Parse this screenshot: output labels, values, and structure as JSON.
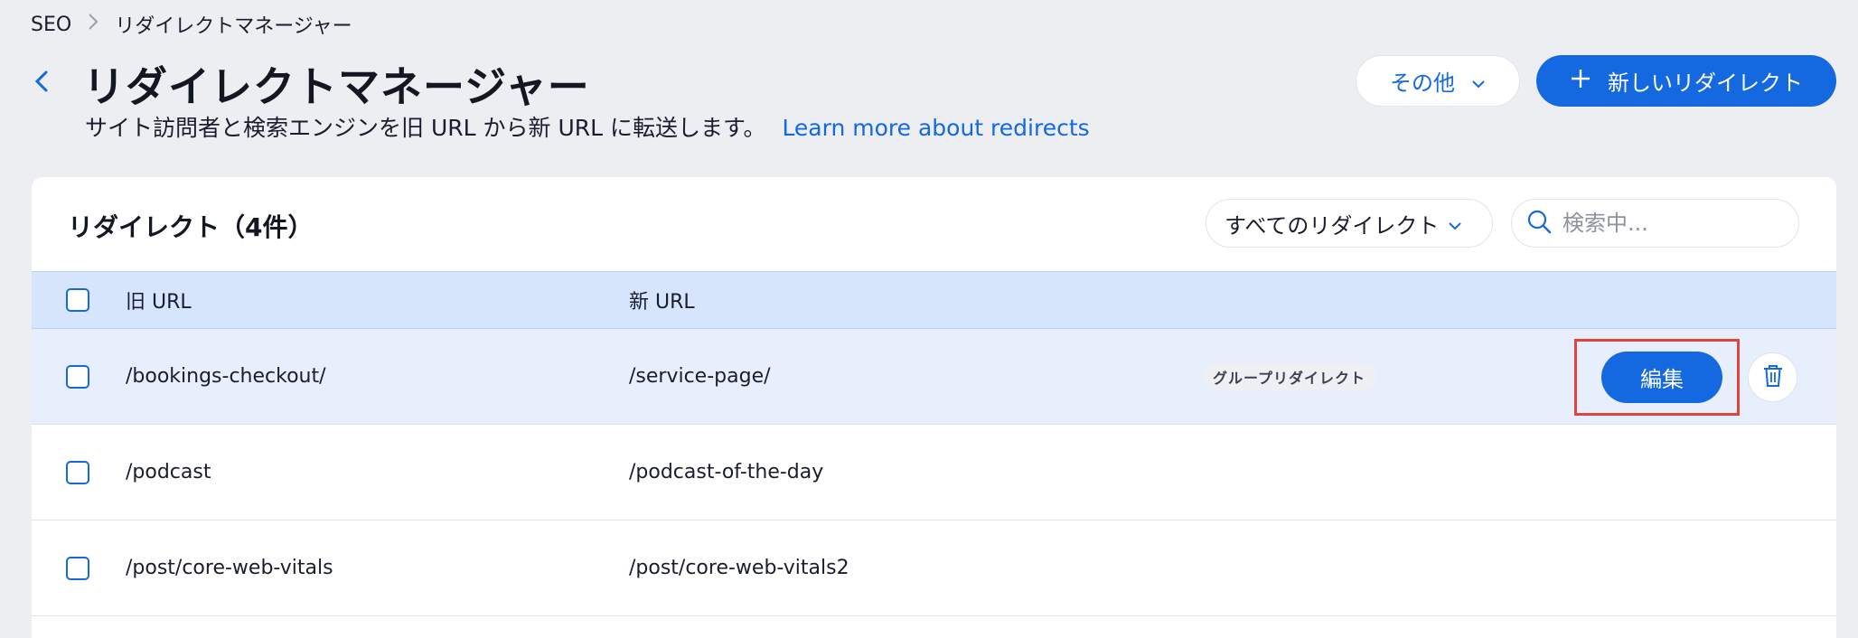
{
  "breadcrumb": {
    "root": "SEO",
    "current": "リダイレクトマネージャー"
  },
  "header": {
    "title": "リダイレクトマネージャー",
    "subtitle": "サイト訪問者と検索エンジンを旧 URL から新 URL に転送します。",
    "learn_more": "Learn more about redirects",
    "more_label": "その他",
    "new_redirect_label": "新しいリダイレクト"
  },
  "card": {
    "title": "リダイレクト（4件）",
    "filter_label": "すべてのリダイレクト",
    "search_placeholder": "検索中..."
  },
  "table": {
    "columns": {
      "old_url": "旧 URL",
      "new_url": "新 URL"
    },
    "rows": [
      {
        "old": "/bookings-checkout/",
        "new": "/service-page/",
        "badge": "グループリダイレクト",
        "edit_label": "編集"
      },
      {
        "old": "/podcast",
        "new": "/podcast-of-the-day"
      },
      {
        "old": "/post/core-web-vitals",
        "new": "/post/core-web-vitals2"
      }
    ]
  },
  "colors": {
    "accent": "#1468e0",
    "selected_row": "#e7effd",
    "header_row": "#d7e5fc",
    "highlight": "#e0453b"
  },
  "icons": [
    "chevron-right-icon",
    "chevron-left-icon",
    "chevron-down-icon",
    "plus-icon",
    "search-icon",
    "trash-icon"
  ]
}
